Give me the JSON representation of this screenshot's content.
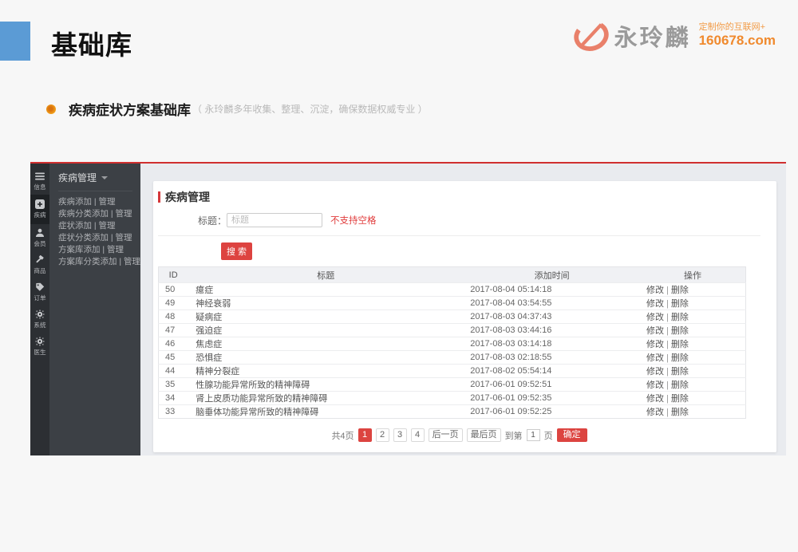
{
  "colors": {
    "accent_red": "#dc4440",
    "accent_blue": "#5b9bd5",
    "brand_coral": "#e9806a",
    "brand_orange": "#f08a2e"
  },
  "header": {
    "page_title": "基础库",
    "logo": {
      "brand": "永玲麟",
      "tagline": "定制你的互联网+",
      "domain": "160678.com"
    }
  },
  "section": {
    "title": "疾病症状方案基础库",
    "subtitle": "（ 永玲麟多年收集、整理、沉淀，确保数据权威专业 ）"
  },
  "sidebar": {
    "items": [
      {
        "key": "info",
        "label": "信息",
        "icon": "menu-icon",
        "active": false
      },
      {
        "key": "disease",
        "label": "疾病",
        "icon": "plus-square-icon",
        "active": true
      },
      {
        "key": "member",
        "label": "会员",
        "icon": "user-icon",
        "active": false
      },
      {
        "key": "product",
        "label": "商品",
        "icon": "hammer-icon",
        "active": false
      },
      {
        "key": "order",
        "label": "订单",
        "icon": "tag-icon",
        "active": false
      },
      {
        "key": "system",
        "label": "系统",
        "icon": "gear-icon",
        "active": false
      },
      {
        "key": "doctor",
        "label": "医生",
        "icon": "gear-icon",
        "active": false
      }
    ]
  },
  "submenu": {
    "header": "疾病管理",
    "items": [
      "疾病添加 | 管理",
      "疾病分类添加 | 管理",
      "症状添加 | 管理",
      "症状分类添加 | 管理",
      "方案库添加 | 管理",
      "方案库分类添加 | 管理"
    ]
  },
  "content": {
    "title": "疾病管理",
    "search": {
      "label": "标题：",
      "placeholder": "标题",
      "hint": "不支持空格",
      "button": "搜 索"
    },
    "table": {
      "headers": [
        "ID",
        "标题",
        "添加时间",
        "操作"
      ],
      "actions": {
        "edit": "修改",
        "separator": "|",
        "delete": "删除"
      },
      "rows": [
        {
          "id": "50",
          "title": "癔症",
          "time": "2017-08-04 05:14:18"
        },
        {
          "id": "49",
          "title": "神经衰弱",
          "time": "2017-08-04 03:54:55"
        },
        {
          "id": "48",
          "title": "疑病症",
          "time": "2017-08-03 04:37:43"
        },
        {
          "id": "47",
          "title": "强迫症",
          "time": "2017-08-03 03:44:16"
        },
        {
          "id": "46",
          "title": "焦虑症",
          "time": "2017-08-03 03:14:18"
        },
        {
          "id": "45",
          "title": "恐惧症",
          "time": "2017-08-03 02:18:55"
        },
        {
          "id": "44",
          "title": "精神分裂症",
          "time": "2017-08-02 05:54:14"
        },
        {
          "id": "35",
          "title": "性腺功能异常所致的精神障碍",
          "time": "2017-06-01 09:52:51"
        },
        {
          "id": "34",
          "title": "肾上皮质功能异常所致的精神障碍",
          "time": "2017-06-01 09:52:35"
        },
        {
          "id": "33",
          "title": "脑垂体功能异常所致的精神障碍",
          "time": "2017-06-01 09:52:25"
        }
      ]
    },
    "pagination": {
      "total": "共4页",
      "pages": [
        "1",
        "2",
        "3",
        "4"
      ],
      "active_page": "1",
      "next": "后一页",
      "last": "最后页",
      "goto_prefix": "到第",
      "goto_value": "1",
      "goto_suffix": "页",
      "confirm": "确定"
    }
  }
}
